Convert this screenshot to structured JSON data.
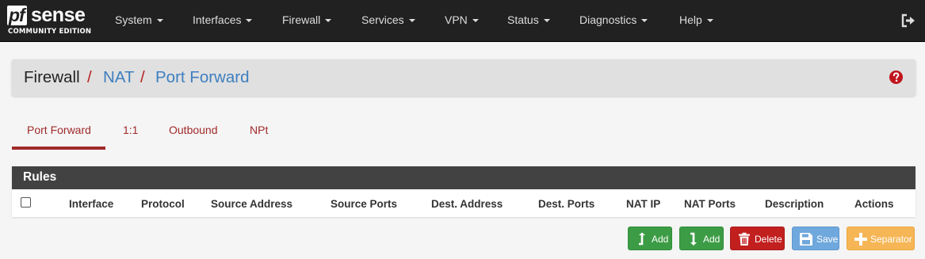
{
  "brand": {
    "pf": "pf",
    "sense": "sense",
    "edition": "COMMUNITY EDITION"
  },
  "nav": {
    "items": [
      {
        "label": "System"
      },
      {
        "label": "Interfaces"
      },
      {
        "label": "Firewall"
      },
      {
        "label": "Services"
      },
      {
        "label": "VPN"
      },
      {
        "label": "Status"
      },
      {
        "label": "Diagnostics"
      },
      {
        "label": "Help"
      }
    ],
    "logout_icon": "logout-icon"
  },
  "breadcrumb": {
    "items": [
      "Firewall",
      "NAT",
      "Port Forward"
    ],
    "separator": "/",
    "help_icon": "question-circle-icon"
  },
  "tabs": {
    "active": "Port Forward",
    "items": [
      {
        "label": "Port Forward"
      },
      {
        "label": "1:1"
      },
      {
        "label": "Outbound"
      },
      {
        "label": "NPt"
      }
    ]
  },
  "rules": {
    "title": "Rules",
    "columns": [
      "Interface",
      "Protocol",
      "Source Address",
      "Source Ports",
      "Dest. Address",
      "Dest. Ports",
      "NAT IP",
      "NAT Ports",
      "Description",
      "Actions"
    ],
    "rows": []
  },
  "actions": {
    "add_top": {
      "label": "Add",
      "icon": "arrow-up-add-icon"
    },
    "add_bottom": {
      "label": "Add",
      "icon": "arrow-down-add-icon"
    },
    "delete": {
      "label": "Delete",
      "icon": "trash-icon"
    },
    "save": {
      "label": "Save",
      "icon": "floppy-disk-icon"
    },
    "separator": {
      "label": "Separator",
      "icon": "plus-icon"
    }
  },
  "colors": {
    "navbar": "#212121",
    "link_blue": "#3d7fbf",
    "accent_red": "#a02a2a",
    "btn_green": "#3c9c45",
    "btn_red": "#c21f1f",
    "btn_blue": "#6fa8dc",
    "btn_orange": "#f6b656"
  }
}
